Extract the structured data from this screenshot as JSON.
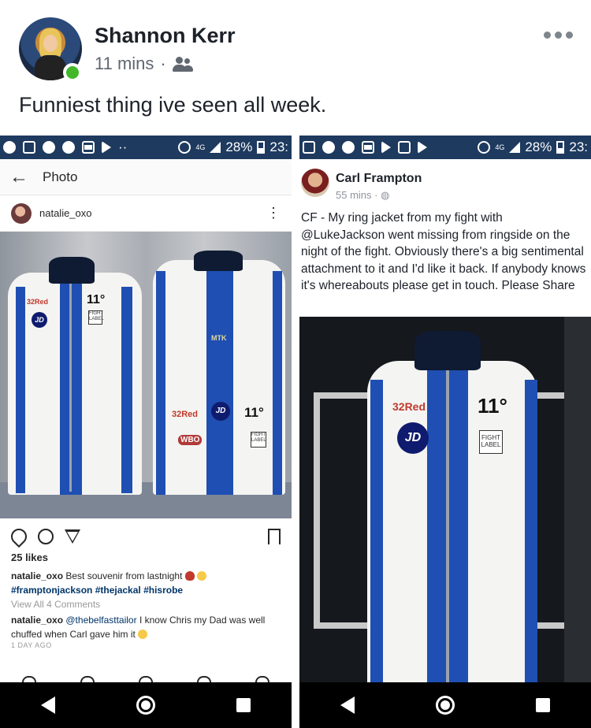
{
  "post": {
    "author": "Shannon Kerr",
    "time": "11 mins",
    "separator": "·",
    "privacy_icon": "friends-icon",
    "text": "Funniest thing ive seen all week.",
    "more_icon": "more-horizontal-icon"
  },
  "statusbar_left": {
    "dots": "··",
    "signal_label": "4G",
    "battery": "28%",
    "time": "23:"
  },
  "statusbar_right": {
    "signal_label": "4G",
    "battery": "28%",
    "time": "23:"
  },
  "instagram": {
    "back_icon": "back-arrow-icon",
    "back_glyph": "←",
    "title": "Photo",
    "username": "natalie_oxo",
    "kebab_glyph": "⋮",
    "likes": "25 likes",
    "caption_user": "natalie_oxo",
    "caption_text": "Best souvenir from lastnight",
    "hashtags": "#framptonjackson #thejackal #hisrobe",
    "view_all": "View All 4 Comments",
    "comment_user": "natalie_oxo",
    "comment_mention": "@thebelfasttailor",
    "comment_text": "I know Chris my Dad was well chuffed when Carl gave him it",
    "time": "1 DAY AGO"
  },
  "facebook_inner": {
    "author": "Carl Frampton",
    "meta": "55 mins · ◍",
    "text": "CF - My ring jacket from my fight with @LukeJackson went missing from ringside on the night of the fight. Obviously there's a big sentimental attachment to it and I'd like it back. If anybody knows it's whereabouts please get in touch. Please Share"
  },
  "robe_labels": {
    "sponsor1": "32Red",
    "sponsor2": "11°",
    "jd": "JD",
    "fight_label": "FIGHT LABEL",
    "wbo": "WBO",
    "mtk": "MTK"
  },
  "colors": {
    "fb_online": "#42b72a",
    "robe_blue": "#1f4fb3",
    "statusbar": "#1e3a5f"
  }
}
